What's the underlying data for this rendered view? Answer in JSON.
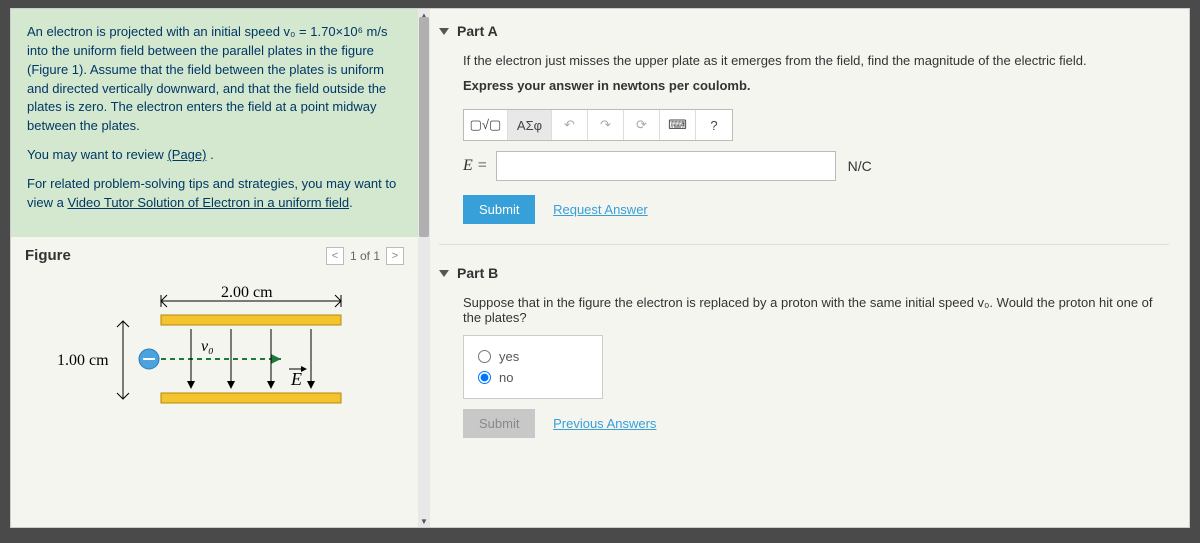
{
  "problem": {
    "p1": "An electron is projected with an initial speed v₀ = 1.70×10⁶ m/s into the uniform field between the parallel plates in the figure (Figure 1). Assume that the field between the plates is uniform and directed vertically downward, and that the field outside the plates is zero. The electron enters the field at a point midway between the plates.",
    "p2_pre": "You may want to review ",
    "p2_link": "(Page)",
    "p2_post": " .",
    "p3_pre": "For related problem-solving tips and strategies, you may want to view a ",
    "p3_link": "Video Tutor Solution of Electron in a uniform field",
    "p3_post": "."
  },
  "figure": {
    "title": "Figure",
    "nav": "1 of 1",
    "width_label": "2.00 cm",
    "height_label": "1.00 cm",
    "v0_label": "v₀",
    "E_label": "E"
  },
  "partA": {
    "title": "Part A",
    "q": "If the electron just misses the upper plate as it emerges from the field, find the magnitude of the electric field.",
    "inst": "Express your answer in newtons per coulomb.",
    "eq": "E =",
    "unit": "N/C",
    "tools": {
      "templates": "▢√▢",
      "greek": "ΑΣφ",
      "undo": "↶",
      "redo": "↷",
      "reset": "⟳",
      "keyboard": "⌨",
      "help": "?"
    },
    "submit": "Submit",
    "request": "Request Answer"
  },
  "partB": {
    "title": "Part B",
    "q": "Suppose that in the figure the electron is replaced by a proton with the same initial speed v₀. Would the proton hit one of the plates?",
    "yes": "yes",
    "no": "no",
    "submit": "Submit",
    "prev": "Previous Answers"
  }
}
